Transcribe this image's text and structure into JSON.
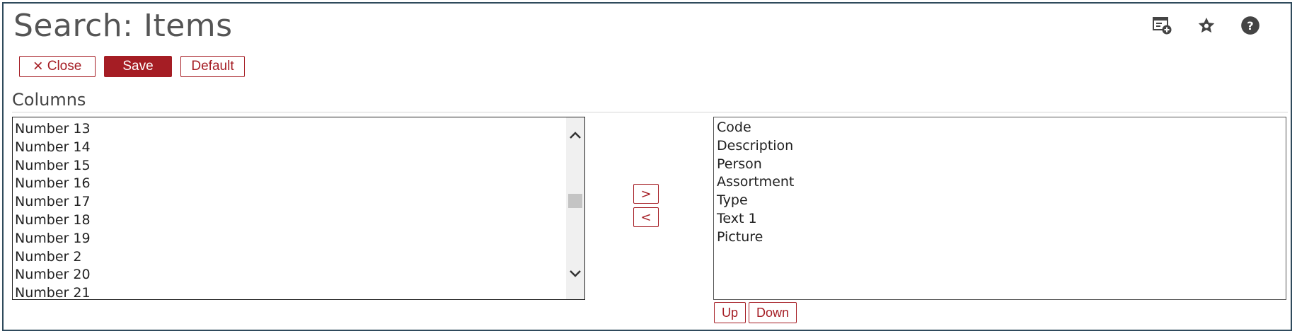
{
  "page": {
    "title": "Search: Items"
  },
  "header_icons": [
    {
      "name": "add-widget-icon"
    },
    {
      "name": "favorite-star-icon"
    },
    {
      "name": "help-icon",
      "glyph": "?"
    }
  ],
  "toolbar": {
    "close_label": "Close",
    "close_icon": "×",
    "save_label": "Save",
    "default_label": "Default"
  },
  "columns": {
    "title": "Columns",
    "available": [
      "Number 13",
      "Number 14",
      "Number 15",
      "Number 16",
      "Number 17",
      "Number 18",
      "Number 19",
      "Number 2",
      "Number 20",
      "Number 21"
    ],
    "selected": [
      "Code",
      "Description",
      "Person",
      "Assortment",
      "Type",
      "Text 1",
      "Picture"
    ],
    "add_label": ">",
    "remove_label": "<",
    "up_label": "Up",
    "down_label": "Down"
  },
  "colors": {
    "accent": "#a51d24",
    "frame": "#2f4a5c"
  }
}
